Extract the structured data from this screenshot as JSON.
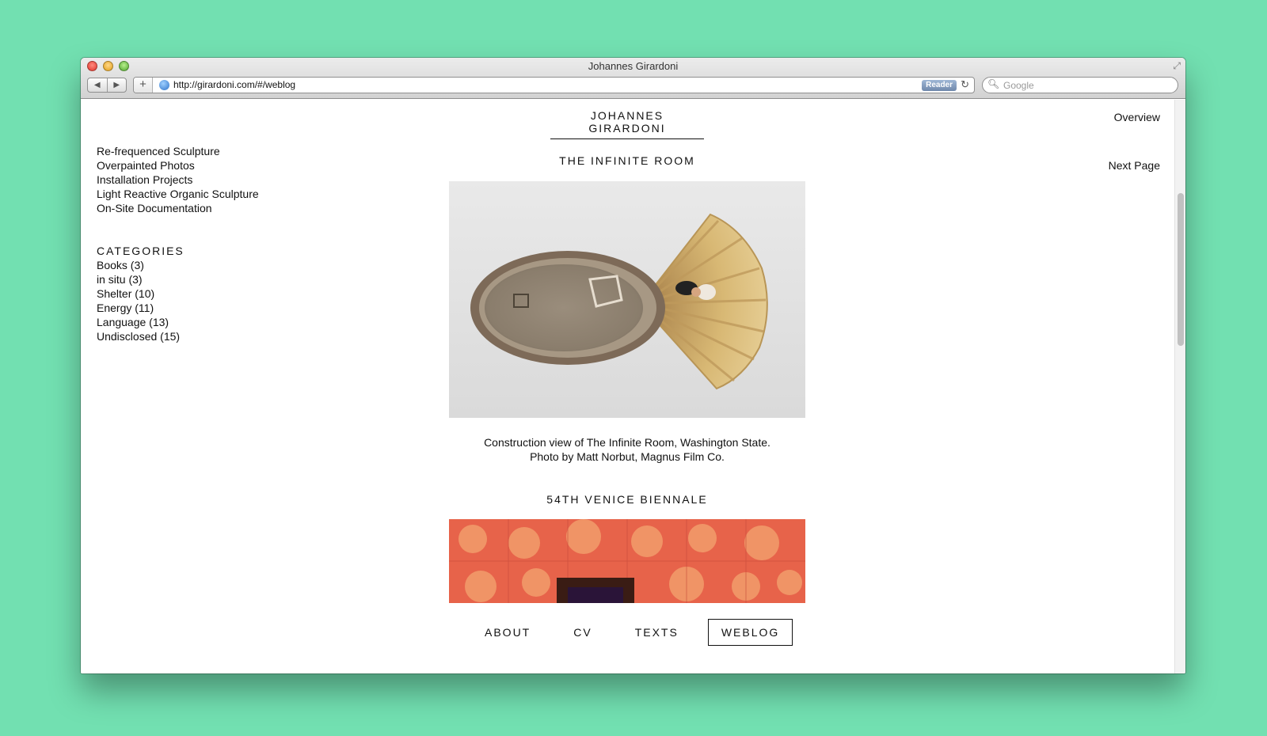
{
  "window": {
    "title": "Johannes Girardoni",
    "url": "http://girardoni.com/#/weblog",
    "reader_label": "Reader",
    "search_placeholder": "Google"
  },
  "site": {
    "title": "JOHANNES GIRARDONI",
    "overview_label": "Overview",
    "next_page_label": "Next Page"
  },
  "sidebar": {
    "projects": [
      "Re-frequenced Sculpture",
      "Overpainted Photos",
      "Installation Projects",
      "Light Reactive Organic Sculpture",
      "On-Site Documentation"
    ],
    "categories_heading": "CATEGORIES",
    "categories": [
      "Books (3)",
      "in situ (3)",
      "Shelter (10)",
      "Energy (11)",
      "Language (13)",
      "Undisclosed (15)"
    ]
  },
  "posts": [
    {
      "title": "THE INFINITE ROOM",
      "caption_line1": "Construction view of The Infinite Room, Washington State.",
      "caption_line2": "Photo by Matt Norbut, Magnus Film Co."
    },
    {
      "title": "54TH VENICE BIENNALE"
    }
  ],
  "bottom_nav": [
    "ABOUT",
    "CV",
    "TEXTS",
    "WEBLOG"
  ],
  "bottom_nav_active": "WEBLOG",
  "colors": {
    "background": "#72e0b1",
    "text": "#111111"
  },
  "icons": [
    "close-icon",
    "minimize-icon",
    "maximize-icon",
    "fullscreen-icon",
    "back-icon",
    "forward-icon",
    "plus-icon",
    "globe-icon",
    "reload-icon",
    "search-icon"
  ]
}
